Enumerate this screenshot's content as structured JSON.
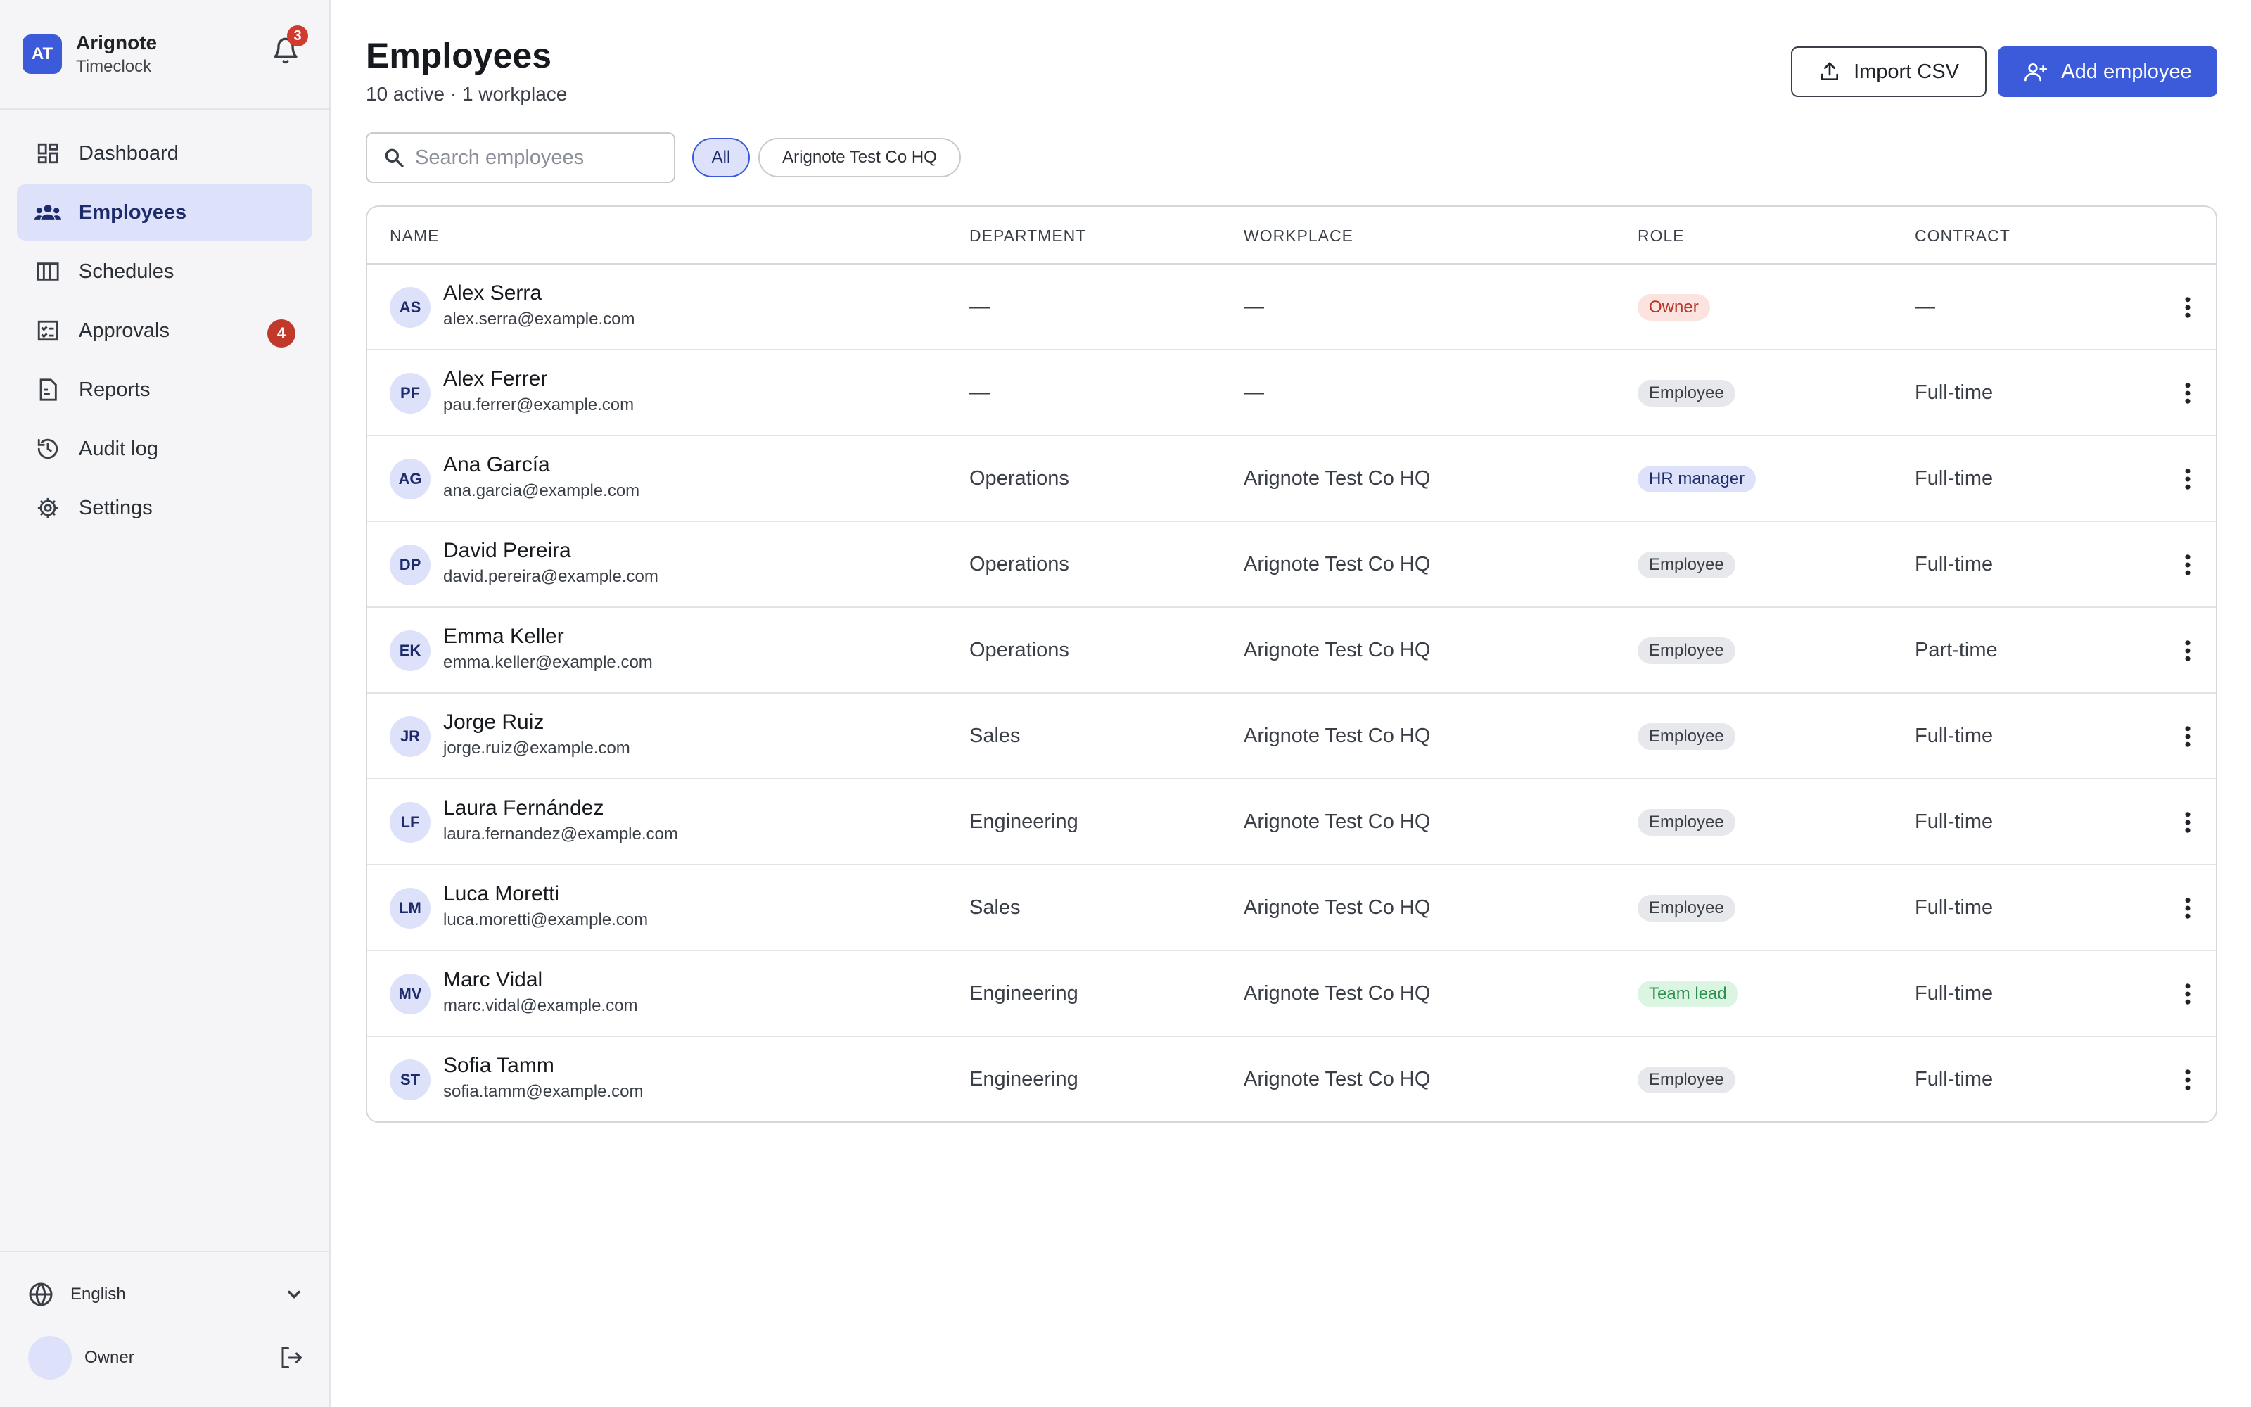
{
  "brand": {
    "logo_initials": "AT",
    "name": "Arignote",
    "product": "Timeclock",
    "notification_count": "3"
  },
  "nav": {
    "items": [
      {
        "label": "Dashboard",
        "icon": "dashboard-icon",
        "active": false
      },
      {
        "label": "Employees",
        "icon": "users-icon",
        "active": true
      },
      {
        "label": "Schedules",
        "icon": "calendar-grid-icon",
        "active": false
      },
      {
        "label": "Approvals",
        "icon": "checklist-icon",
        "active": false,
        "badge": "4"
      },
      {
        "label": "Reports",
        "icon": "report-icon",
        "active": false
      },
      {
        "label": "Audit log",
        "icon": "history-icon",
        "active": false
      },
      {
        "label": "Settings",
        "icon": "gear-icon",
        "active": false
      }
    ]
  },
  "footer": {
    "language": "English",
    "user_role": "Owner"
  },
  "header": {
    "title": "Employees",
    "subtitle": "10 active · 1 workplace",
    "import_label": "Import CSV",
    "add_label": "Add employee"
  },
  "filters": {
    "search_placeholder": "Search employees",
    "chips": [
      "All",
      "Arignote Test Co HQ"
    ],
    "selected": "All"
  },
  "table": {
    "columns": [
      "NAME",
      "DEPARTMENT",
      "WORKPLACE",
      "ROLE",
      "CONTRACT"
    ],
    "rows": [
      {
        "initials": "AS",
        "name": "Alex Serra",
        "email": "alex.serra@example.com",
        "department": "—",
        "workplace": "—",
        "role": "Owner",
        "contract": "—"
      },
      {
        "initials": "PF",
        "name": "Alex Ferrer",
        "email": "pau.ferrer@example.com",
        "department": "—",
        "workplace": "—",
        "role": "Employee",
        "contract": "Full-time"
      },
      {
        "initials": "AG",
        "name": "Ana García",
        "email": "ana.garcia@example.com",
        "department": "Operations",
        "workplace": "Arignote Test Co HQ",
        "role": "HR manager",
        "contract": "Full-time"
      },
      {
        "initials": "DP",
        "name": "David Pereira",
        "email": "david.pereira@example.com",
        "department": "Operations",
        "workplace": "Arignote Test Co HQ",
        "role": "Employee",
        "contract": "Full-time"
      },
      {
        "initials": "EK",
        "name": "Emma Keller",
        "email": "emma.keller@example.com",
        "department": "Operations",
        "workplace": "Arignote Test Co HQ",
        "role": "Employee",
        "contract": "Part-time"
      },
      {
        "initials": "JR",
        "name": "Jorge Ruiz",
        "email": "jorge.ruiz@example.com",
        "department": "Sales",
        "workplace": "Arignote Test Co HQ",
        "role": "Employee",
        "contract": "Full-time"
      },
      {
        "initials": "LF",
        "name": "Laura Fernández",
        "email": "laura.fernandez@example.com",
        "department": "Engineering",
        "workplace": "Arignote Test Co HQ",
        "role": "Employee",
        "contract": "Full-time"
      },
      {
        "initials": "LM",
        "name": "Luca Moretti",
        "email": "luca.moretti@example.com",
        "department": "Sales",
        "workplace": "Arignote Test Co HQ",
        "role": "Employee",
        "contract": "Full-time"
      },
      {
        "initials": "MV",
        "name": "Marc Vidal",
        "email": "marc.vidal@example.com",
        "department": "Engineering",
        "workplace": "Arignote Test Co HQ",
        "role": "Team lead",
        "contract": "Full-time"
      },
      {
        "initials": "ST",
        "name": "Sofia Tamm",
        "email": "sofia.tamm@example.com",
        "department": "Engineering",
        "workplace": "Arignote Test Co HQ",
        "role": "Employee",
        "contract": "Full-time"
      }
    ]
  },
  "colors": {
    "accent": "#3b5bdb",
    "accent_soft": "#dde2fa",
    "badge_red": "#c0392b",
    "owner_bg": "#fde3df",
    "lead_bg": "#dcf5e3"
  }
}
